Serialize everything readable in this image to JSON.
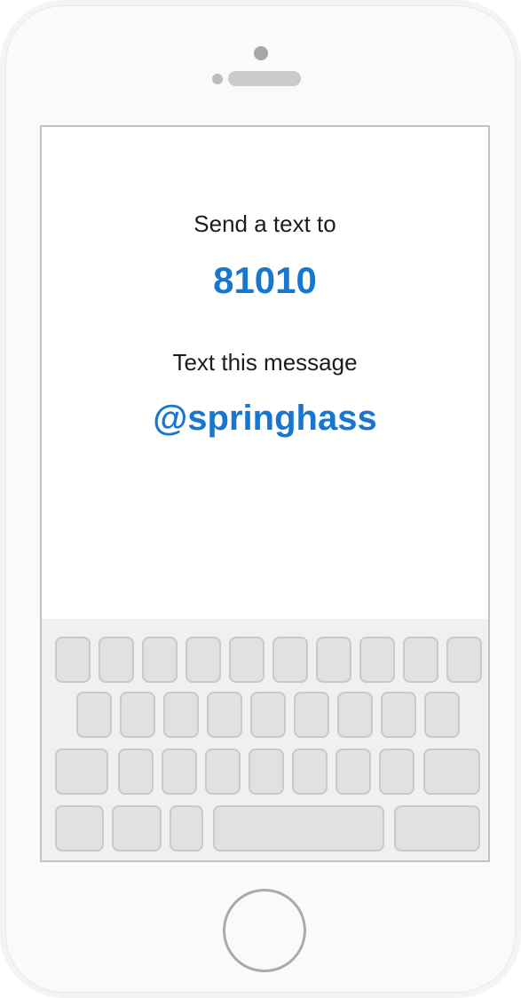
{
  "screen": {
    "send_label": "Send a text to",
    "phone_number": "81010",
    "message_label": "Text this message",
    "keyword": "@springhass"
  },
  "colors": {
    "accent_blue": "#1776cf",
    "text_dark": "#1c1c1c",
    "frame_grey": "#c2c2c2",
    "key_fill": "#e1e1e1"
  },
  "icons": {
    "camera": "camera-icon",
    "speaker": "speaker-grille-icon",
    "home": "home-button-icon"
  }
}
